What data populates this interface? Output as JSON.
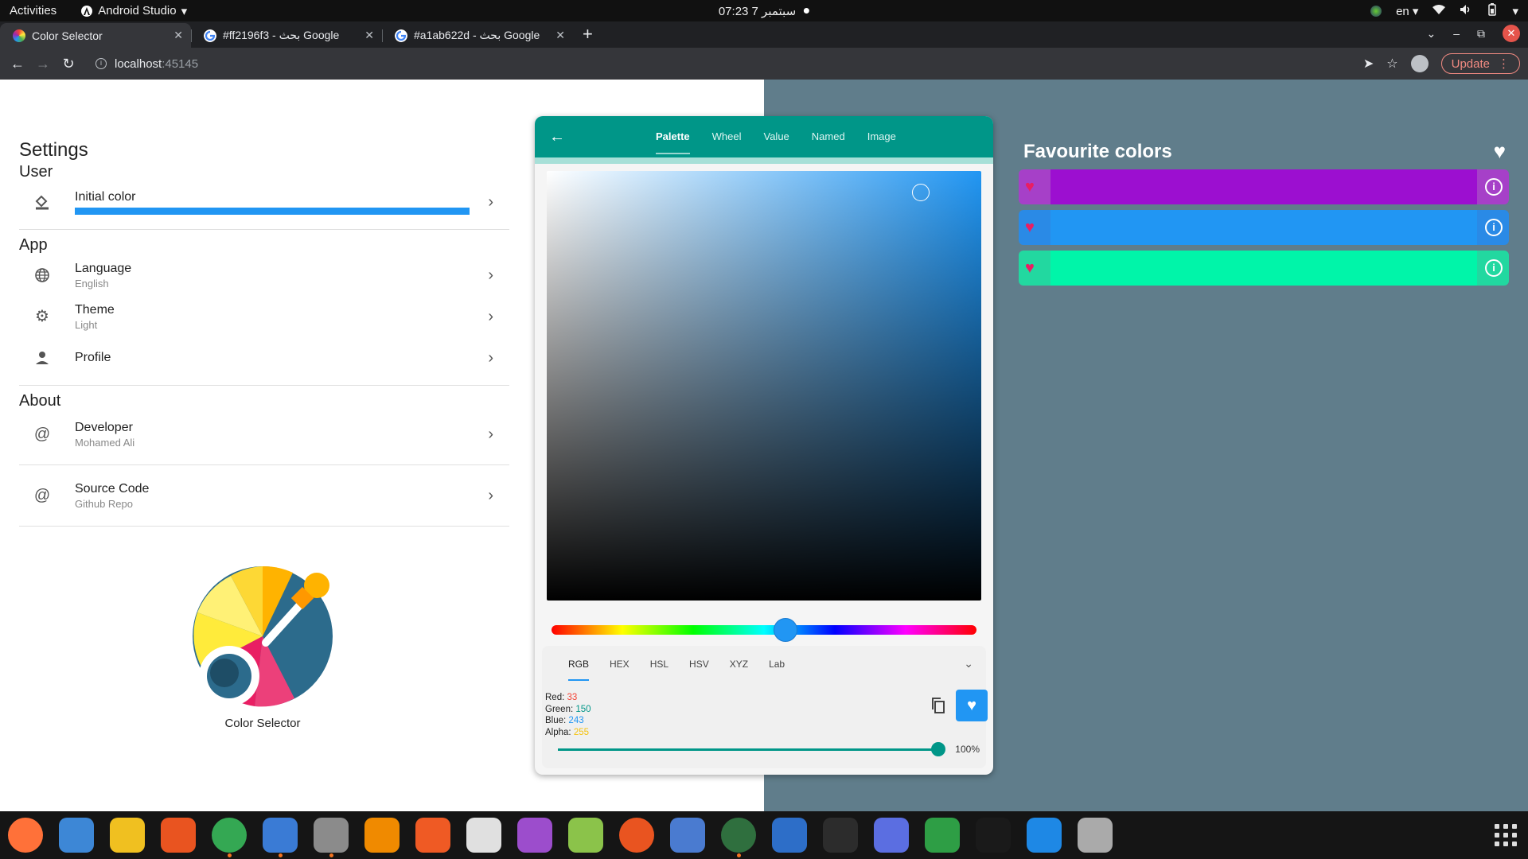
{
  "topbar": {
    "activities": "Activities",
    "app_name": "Android Studio",
    "clock": "07:23  7 سبتمبر",
    "lang": "en"
  },
  "browser": {
    "tabs": [
      {
        "title": "Color Selector",
        "favicon_color": "#f4b400",
        "active": true
      },
      {
        "title": "#ff2196f3 - بحث Google",
        "favicon_color": "#4285f4",
        "active": false
      },
      {
        "title": "#a1ab622d - بحث Google",
        "favicon_color": "#4285f4",
        "active": false
      }
    ],
    "url_host": "localhost",
    "url_port": ":45145",
    "update_label": "Update"
  },
  "settings": {
    "title": "Settings",
    "user_section": "User",
    "initial_color_label": "Initial color",
    "initial_color_value": "#2196f3",
    "app_section": "App",
    "language_label": "Language",
    "language_value": "English",
    "theme_label": "Theme",
    "theme_value": "Light",
    "profile_label": "Profile",
    "about_section": "About",
    "developer_label": "Developer",
    "developer_value": "Mohamed Ali",
    "source_label": "Source Code",
    "source_value": "Github Repo",
    "logo_caption": "Color Selector"
  },
  "picker": {
    "tabs": [
      "Palette",
      "Wheel",
      "Value",
      "Named",
      "Image"
    ],
    "active_tab": "Palette",
    "value_tabs": [
      "RGB",
      "HEX",
      "HSL",
      "HSV",
      "XYZ",
      "Lab"
    ],
    "active_value_tab": "RGB",
    "red_label": "Red:",
    "red_value": "33",
    "green_label": "Green:",
    "green_value": "150",
    "blue_label": "Blue:",
    "blue_value": "243",
    "alpha_label": "Alpha:",
    "alpha_value": "255",
    "alpha_percent": "100%",
    "alpha_fraction": 1.0,
    "hue_fraction": 0.55,
    "saturation": 0.86,
    "brightness": 0.95,
    "current_color": "#2196f3",
    "value_colors": {
      "red": "#f44336",
      "green": "#009688",
      "blue": "#2196f3",
      "alpha": "#f4c20d"
    }
  },
  "favourites": {
    "title": "Favourite colors",
    "colors": [
      "#9c0fd0",
      "#2196f3",
      "#00f5a9"
    ],
    "edge_colors": [
      "#a640c8",
      "#2a8ae6",
      "#22d8a0"
    ]
  },
  "dock": {
    "items": [
      {
        "name": "firefox-icon",
        "color": "#ff7139"
      },
      {
        "name": "thunderbird-icon",
        "color": "#3d87d6"
      },
      {
        "name": "rhythmbox-icon",
        "color": "#f0c020"
      },
      {
        "name": "app-center-icon",
        "color": "#e95420"
      },
      {
        "name": "chrome-icon",
        "color": "#34a853"
      },
      {
        "name": "android-studio-icon",
        "color": "#3a7bd5"
      },
      {
        "name": "files-icon",
        "color": "#8b8b8b"
      },
      {
        "name": "vlc-icon",
        "color": "#f08a00"
      },
      {
        "name": "inkscape-pen-icon",
        "color": "#ef5a24"
      },
      {
        "name": "reader-icon",
        "color": "#e0e0e0"
      },
      {
        "name": "video-player-icon",
        "color": "#9c4dcc"
      },
      {
        "name": "android-icon",
        "color": "#8bc34a"
      },
      {
        "name": "ubuntu-icon",
        "color": "#e95420"
      },
      {
        "name": "tasks-icon",
        "color": "#4a7bd0"
      },
      {
        "name": "gimp-icon",
        "color": "#2f6f3e"
      },
      {
        "name": "writer-icon",
        "color": "#2d6ec8"
      },
      {
        "name": "terminal-icon",
        "color": "#2c2c2c"
      },
      {
        "name": "screenshot-icon",
        "color": "#5b6ee1"
      },
      {
        "name": "calc-icon",
        "color": "#2e9e45"
      },
      {
        "name": "intellij-icon",
        "color": "#1a1a1a"
      },
      {
        "name": "vscode-icon",
        "color": "#1e88e5"
      },
      {
        "name": "updater-icon",
        "color": "#aaaaaa"
      }
    ]
  }
}
